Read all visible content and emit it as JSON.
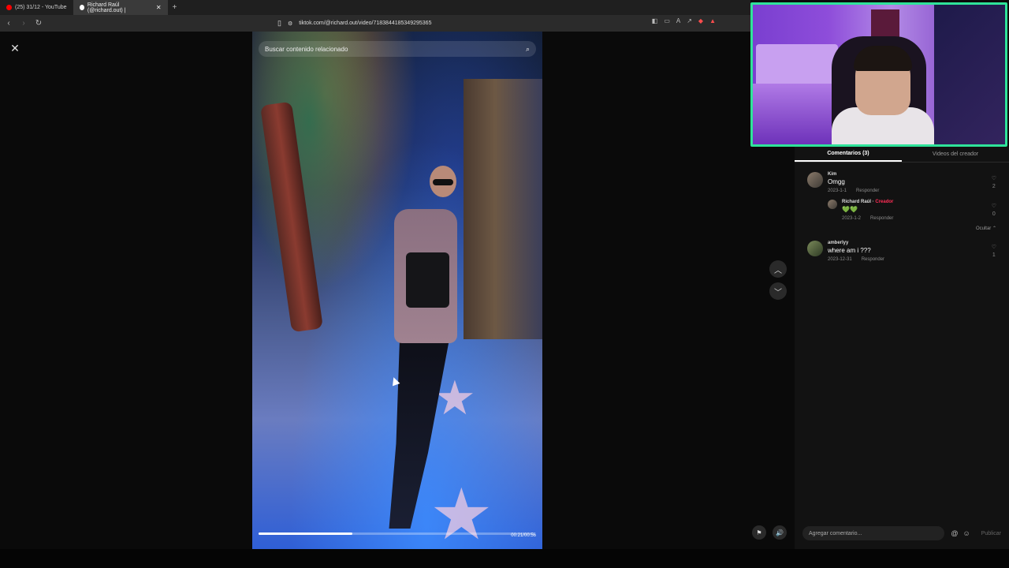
{
  "browser": {
    "tabs": [
      {
        "label": "(25) 31/12 - YouTube",
        "favicon": "youtube-icon"
      },
      {
        "label": "Richard Raúl (@richard.out) |",
        "favicon": "tiktok-icon"
      }
    ],
    "url": "tiktok.com/@richard.out/video/7183844185349295365"
  },
  "video": {
    "search_placeholder": "Buscar contenido relacionado",
    "timecode": "00:21/00:56",
    "progress_fraction": 0.34
  },
  "comments": {
    "tabs": [
      {
        "label": "Comentarios (3)",
        "active": true
      },
      {
        "label": "Videos del creador",
        "active": false
      }
    ],
    "items": [
      {
        "user": "Kim",
        "text": "Omgg",
        "date": "2023-1-1",
        "reply_label": "Responder",
        "likes": "2",
        "replies": [
          {
            "user": "Richard Raúl",
            "badge": "Creador",
            "text": "💚💚",
            "date": "2023-1-2",
            "reply_label": "Responder",
            "likes": "0"
          }
        ],
        "hide_label": "Ocultar"
      },
      {
        "user": "amberlyy",
        "text": "where am i ???",
        "date": "2023-12-31",
        "reply_label": "Responder",
        "likes": "1"
      }
    ],
    "add_placeholder": "Agregar comentario...",
    "publish_label": "Publicar"
  }
}
